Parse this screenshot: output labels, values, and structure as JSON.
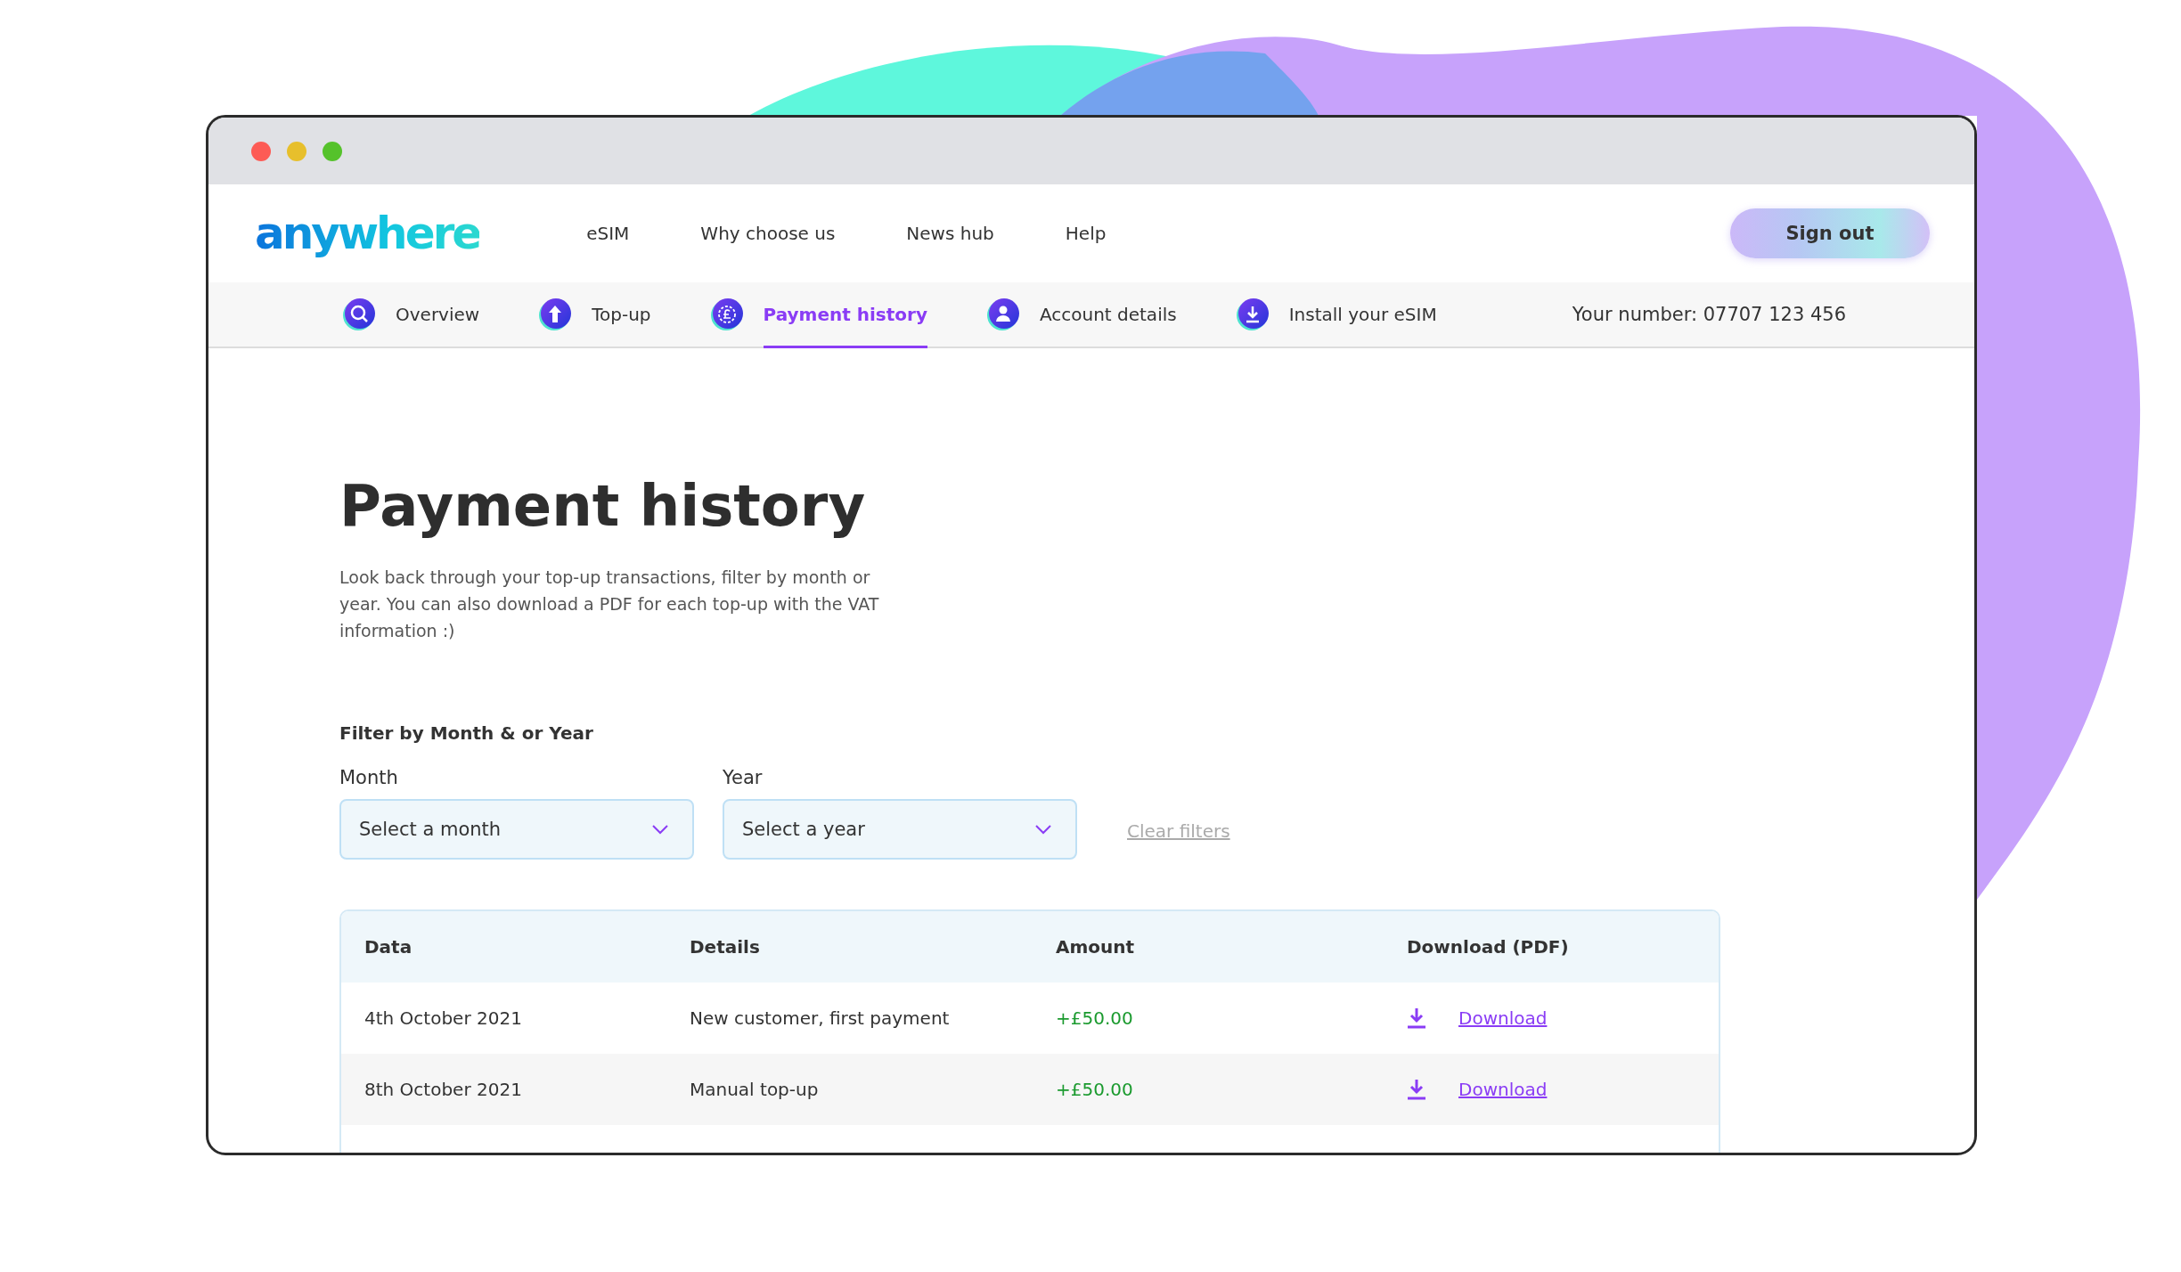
{
  "header": {
    "logo": "anywhere",
    "nav": [
      "eSIM",
      "Why choose us",
      "News hub",
      "Help"
    ],
    "sign_out": "Sign out"
  },
  "tabs": [
    {
      "label": "Overview",
      "selected": false
    },
    {
      "label": "Top-up",
      "selected": false
    },
    {
      "label": "Payment history",
      "selected": true
    },
    {
      "label": "Account details",
      "selected": false
    },
    {
      "label": "Install your eSIM",
      "selected": false
    }
  ],
  "your_number": "Your number: 07707 123 456",
  "page": {
    "title": "Payment history",
    "intro": "Look back through your top-up transactions, filter by month or year. You can also download a PDF for each top-up with the VAT information :)"
  },
  "filters": {
    "heading": "Filter by Month & or Year",
    "fields": [
      {
        "label": "Month",
        "placeholder": "Select a month"
      },
      {
        "label": "Year",
        "placeholder": "Select a year"
      }
    ],
    "clear": "Clear filters"
  },
  "table": {
    "columns": [
      "Data",
      "Details",
      "Amount",
      "Download (PDF)"
    ],
    "rows": [
      {
        "date": "4th October 2021",
        "details": "New customer, first payment",
        "amount": "+£50.00",
        "download": "Download"
      },
      {
        "date": "8th October 2021",
        "details": "Manual top-up",
        "amount": "+£50.00",
        "download": "Download"
      }
    ]
  }
}
